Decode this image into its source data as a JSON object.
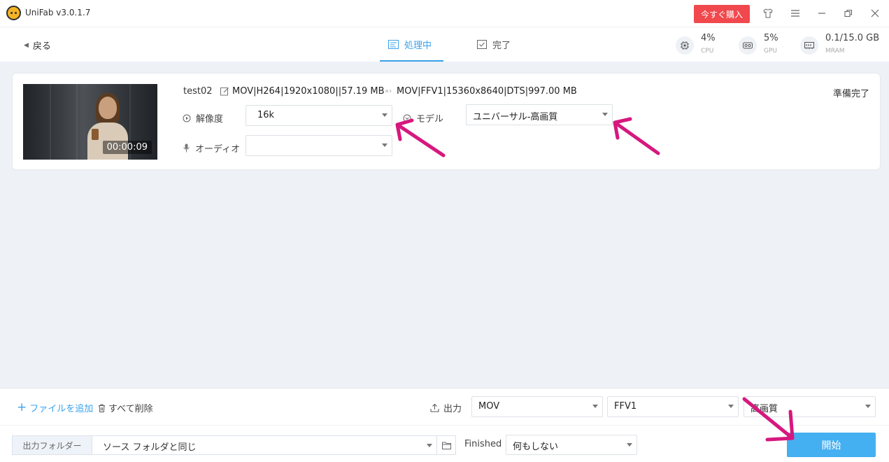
{
  "app": {
    "title": "UniFab v3.0.1.7",
    "buy_label": "今すぐ購入"
  },
  "nav": {
    "back_label": "戻る",
    "tabs": [
      {
        "label": "処理中",
        "active": true
      },
      {
        "label": "完了",
        "active": false
      }
    ],
    "stats": [
      {
        "value": "4%",
        "label": "CPU",
        "icon": "cpu-icon"
      },
      {
        "value": "5%",
        "label": "GPU",
        "icon": "gpu-icon"
      },
      {
        "value": "0.1/15.0 GB",
        "label": "MRAM",
        "icon": "memory-icon"
      }
    ]
  },
  "file": {
    "name": "test02",
    "duration": "00:00:09",
    "source_info": "MOV|H264|1920x1080||57.19 MB",
    "target_info": "MOV|FFV1|15360x8640|DTS|997.00 MB",
    "status": "準備完了",
    "resolution_label": "解像度",
    "resolution_value": "16k",
    "model_label": "モデル",
    "model_value": "ユニバーサル-高画質",
    "audio_label": "オーディオ",
    "audio_value": ""
  },
  "bottom": {
    "add_file": "ファイルを追加",
    "delete_all": "すべて削除",
    "output_label": "出力",
    "output_format": "MOV",
    "output_codec": "FFV1",
    "output_quality": "高画質",
    "folder_label": "出力フォルダー",
    "folder_value": "ソース フォルダと同じ",
    "finished_label": "Finished",
    "finished_value": "何もしない",
    "start_label": "開始"
  },
  "colors": {
    "accent": "#3aa3ec",
    "buy": "#f0484d",
    "start": "#44aff1",
    "annotation": "#d6187e"
  }
}
